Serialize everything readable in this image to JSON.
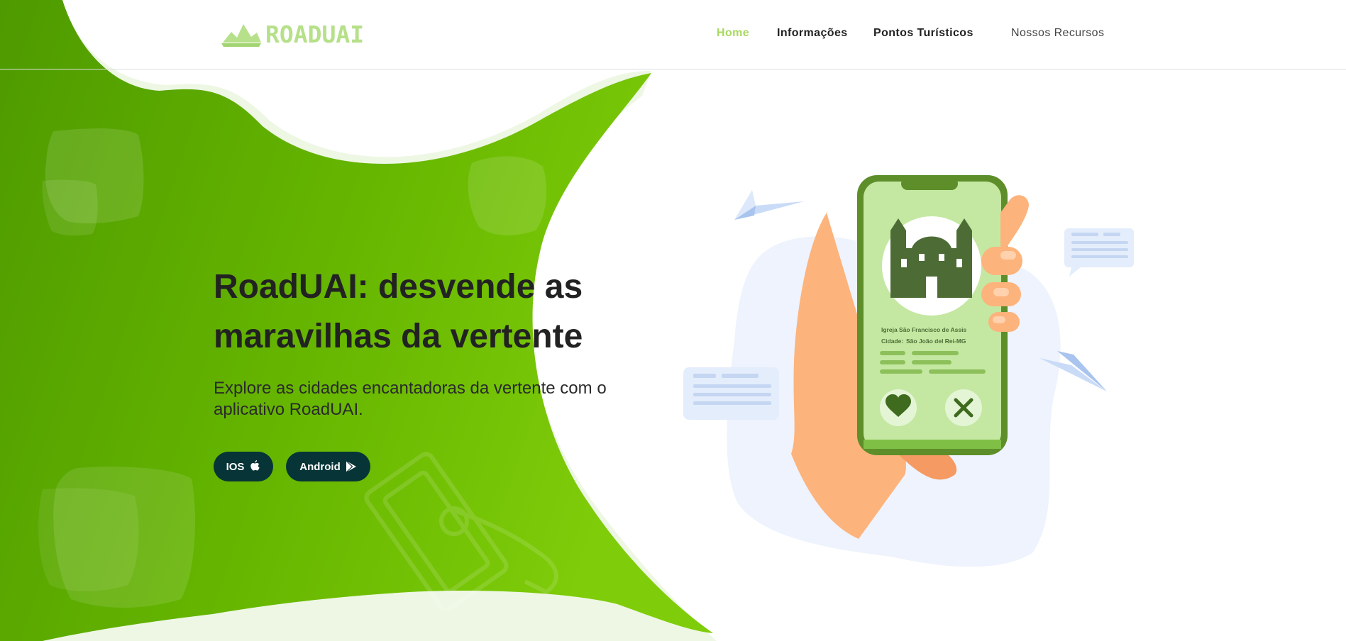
{
  "header": {
    "logo_text": "ROADUAI",
    "nav": [
      {
        "label": "Home",
        "active": true
      },
      {
        "label": "Informações"
      },
      {
        "label": "Pontos Turísticos"
      },
      {
        "label": "Nossos Recursos"
      }
    ]
  },
  "hero": {
    "title": "RoadUAI: desvende as maravilhas da vertente",
    "subtitle": "Explore as cidades encantadoras da vertente com o aplicativo RoadUAI.",
    "buttons": {
      "ios": {
        "label": "IOS",
        "icon": "apple-icon"
      },
      "android": {
        "label": "Android",
        "icon": "play-store-icon"
      }
    }
  },
  "phone_card": {
    "place_label": "Igreja São Francisco de Assis",
    "city_label": "Cidade:",
    "city_value": "São João del Rei-MG",
    "like_icon": "heart-icon",
    "dismiss_icon": "close-icon"
  },
  "colors": {
    "brand_green": "#6ab800",
    "logo_green": "#b6e089",
    "nav_active": "#a8d861",
    "button_bg": "#073437",
    "text_dark": "#222222"
  }
}
